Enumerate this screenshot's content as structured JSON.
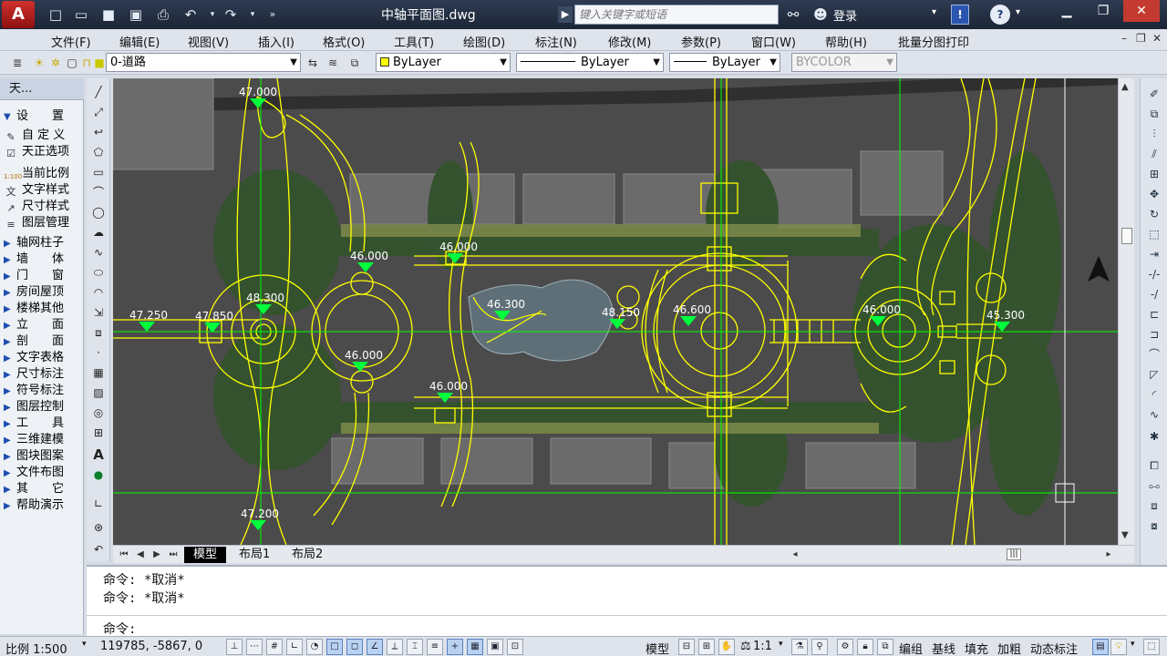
{
  "window": {
    "title": "中轴平面图.dwg",
    "search_placeholder": "键入关键字或短语",
    "login_label": "登录"
  },
  "menu": [
    "文件(F)",
    "编辑(E)",
    "视图(V)",
    "插入(I)",
    "格式(O)",
    "工具(T)",
    "绘图(D)",
    "标注(N)",
    "修改(M)",
    "参数(P)",
    "窗口(W)",
    "帮助(H)",
    "批量分图打印"
  ],
  "properties": {
    "layer": "0-道路",
    "color": "ByLayer",
    "linetype": "ByLayer",
    "lineweight": "ByLayer",
    "plotstyle": "BYCOLOR"
  },
  "left_panel": {
    "title": "天...",
    "items": [
      "设　　置",
      "自 定 义",
      "天正选项",
      "当前比例",
      "文字样式",
      "尺寸样式",
      "图层管理",
      "轴网柱子",
      "墙　　体",
      "门　　窗",
      "房间屋顶",
      "楼梯其他",
      "立　　面",
      "剖　　面",
      "文字表格",
      "尺寸标注",
      "符号标注",
      "图层控制",
      "工　　具",
      "三维建模",
      "图块图案",
      "文件布图",
      "其　　它",
      "帮助演示"
    ]
  },
  "elevations": [
    "47.000",
    "46.000",
    "46.000",
    "47.250",
    "47.850",
    "48.300",
    "46.000",
    "46.300",
    "46.000",
    "48.150",
    "46.600",
    "46.000",
    "45.300",
    "47.200"
  ],
  "tabs": [
    "模型",
    "布局1",
    "布局2"
  ],
  "command": {
    "lines": [
      "命令: *取消*",
      "命令: *取消*"
    ],
    "prompt": "命令:"
  },
  "status": {
    "scale": "比例 1:500",
    "coords": "119785, -5867, 0",
    "model": "模型",
    "annotation_scale": "1:1",
    "buttons": [
      "编组",
      "基线",
      "填充",
      "加粗",
      "动态标注"
    ]
  },
  "colors": {
    "canvas": "#4b4b4b",
    "cad_yellow": "#ffff00",
    "cad_green": "#00ff00",
    "titlebar": "#1b2535"
  }
}
